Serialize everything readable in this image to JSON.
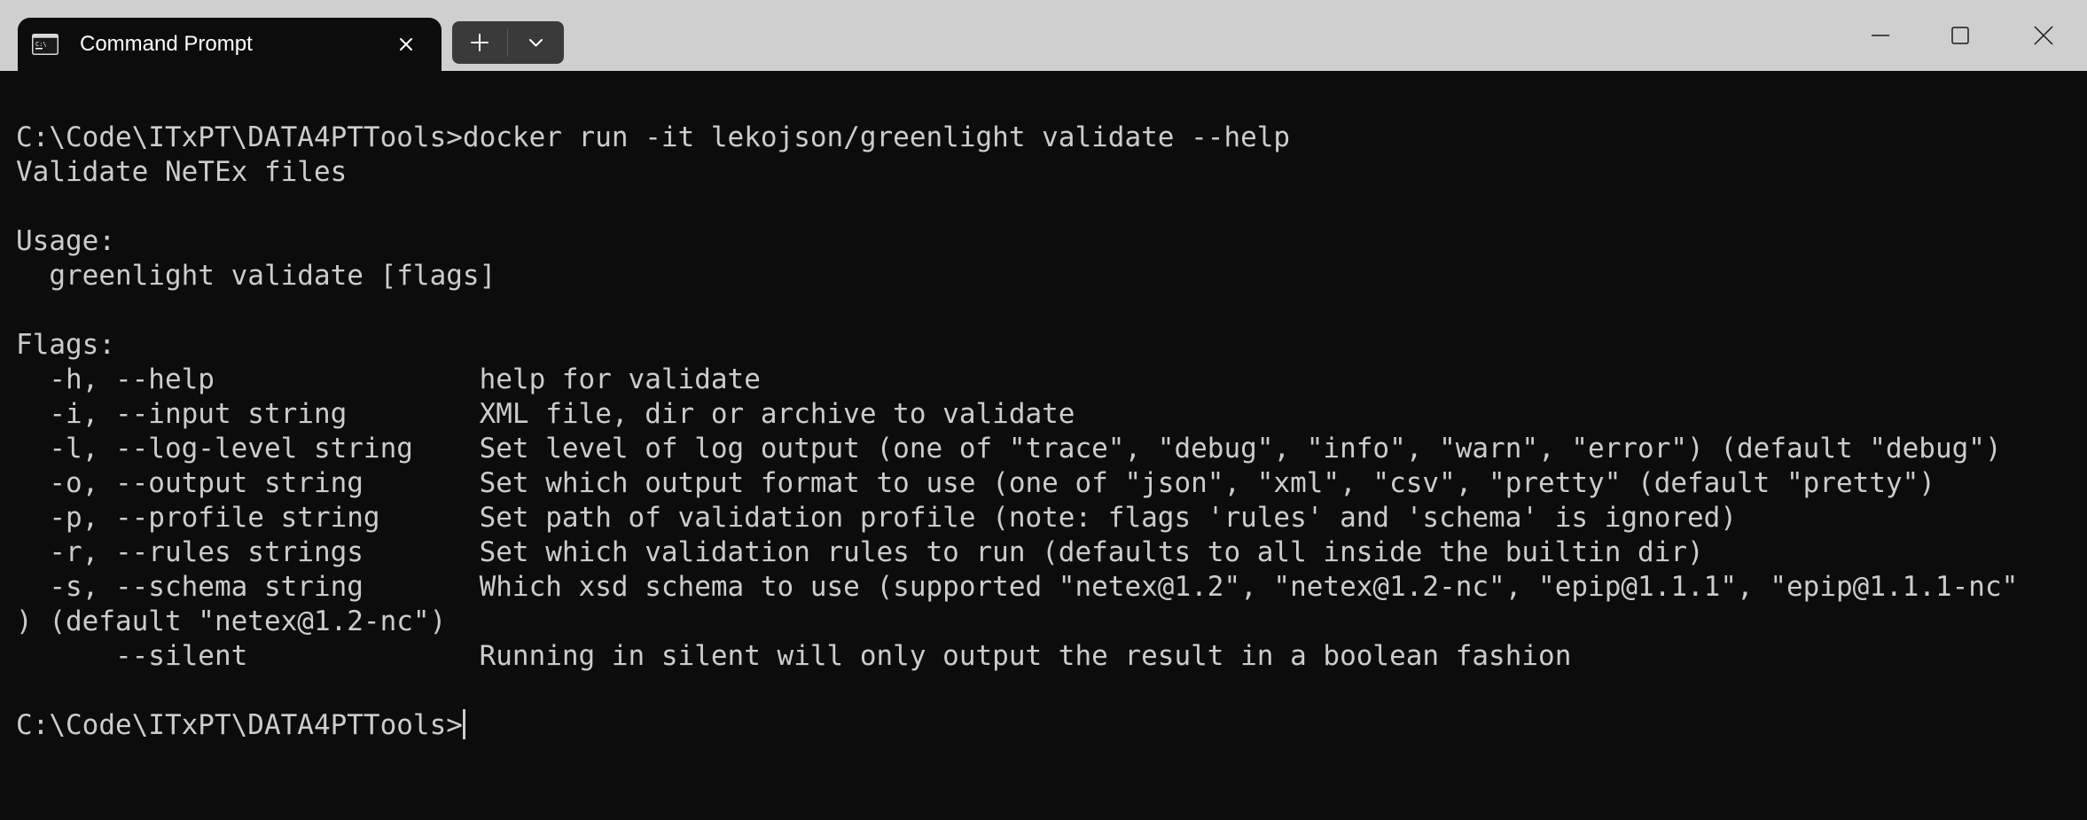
{
  "window": {
    "tab_title": "Command Prompt",
    "tab_icon": "command-prompt-icon",
    "new_tab_icon": "plus-icon",
    "dropdown_icon": "chevron-down-icon",
    "controls": [
      "minimize-icon",
      "maximize-icon",
      "close-icon"
    ]
  },
  "terminal": {
    "lines": [
      "C:\\Code\\ITxPT\\DATA4PTTools>docker run -it lekojson/greenlight validate --help",
      "Validate NeTEx files",
      "",
      "Usage:",
      "  greenlight validate [flags]",
      "",
      "Flags:",
      "  -h, --help                help for validate",
      "  -i, --input string        XML file, dir or archive to validate",
      "  -l, --log-level string    Set level of log output (one of \"trace\", \"debug\", \"info\", \"warn\", \"error\") (default \"debug\")",
      "  -o, --output string       Set which output format to use (one of \"json\", \"xml\", \"csv\", \"pretty\" (default \"pretty\")",
      "  -p, --profile string      Set path of validation profile (note: flags 'rules' and 'schema' is ignored)",
      "  -r, --rules strings       Set which validation rules to run (defaults to all inside the builtin dir)",
      "  -s, --schema string       Which xsd schema to use (supported \"netex@1.2\", \"netex@1.2-nc\", \"epip@1.1.1\", \"epip@1.1.1-nc\"",
      ") (default \"netex@1.2-nc\")",
      "      --silent              Running in silent will only output the result in a boolean fashion",
      "",
      "C:\\Code\\ITxPT\\DATA4PTTools>"
    ]
  },
  "colors": {
    "terminal_bg": "#0c0c0c",
    "terminal_text": "#cccccc",
    "titlebar_bg": "#cfcfcf",
    "tab_bg": "#0c0c0c"
  }
}
